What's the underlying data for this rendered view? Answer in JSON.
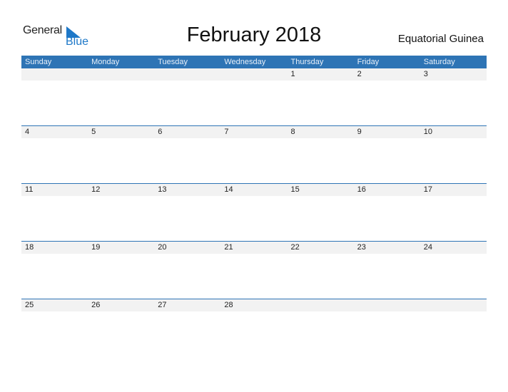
{
  "logo": {
    "line1": "General",
    "line2": "Blue",
    "accent": "#1e78c8"
  },
  "title": "February 2018",
  "country": "Equatorial Guinea",
  "colors": {
    "header_bg": "#2e74b5",
    "strip_bg": "#f2f2f2"
  },
  "weekdays": [
    "Sunday",
    "Monday",
    "Tuesday",
    "Wednesday",
    "Thursday",
    "Friday",
    "Saturday"
  ],
  "weeks": [
    [
      "",
      "",
      "",
      "",
      "1",
      "2",
      "3"
    ],
    [
      "4",
      "5",
      "6",
      "7",
      "8",
      "9",
      "10"
    ],
    [
      "11",
      "12",
      "13",
      "14",
      "15",
      "16",
      "17"
    ],
    [
      "18",
      "19",
      "20",
      "21",
      "22",
      "23",
      "24"
    ],
    [
      "25",
      "26",
      "27",
      "28",
      "",
      "",
      ""
    ]
  ]
}
